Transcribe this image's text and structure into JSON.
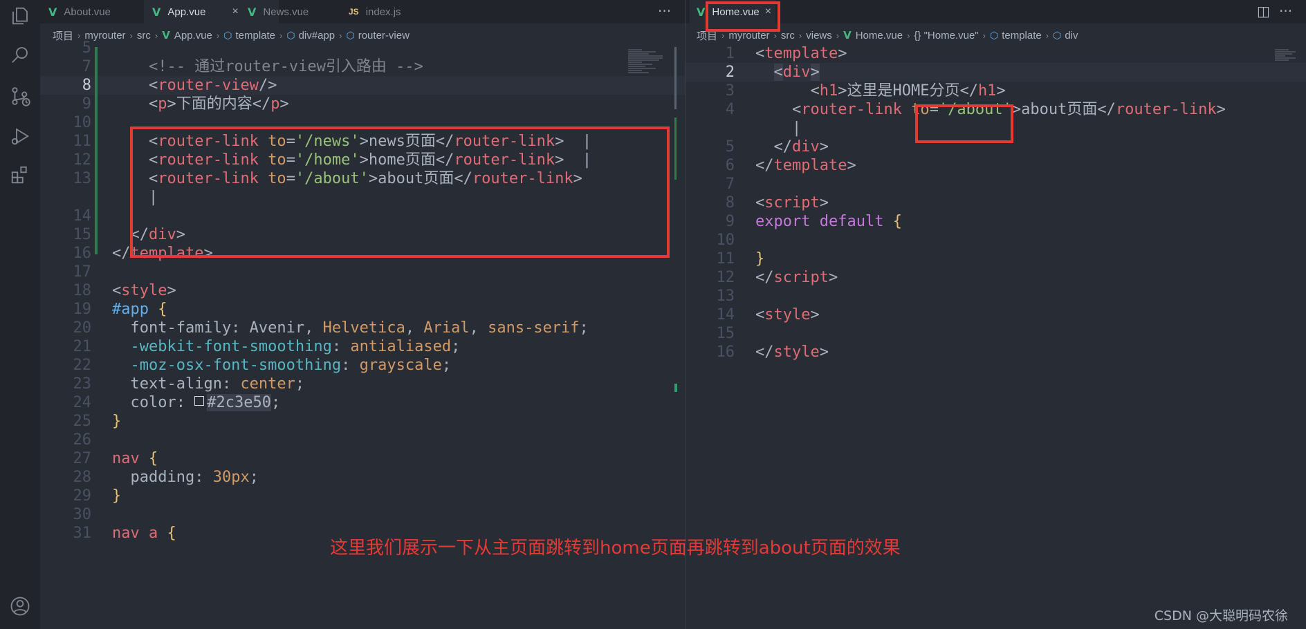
{
  "left_editor": {
    "tabs": [
      {
        "icon": "vue-icon",
        "label": "About.vue"
      },
      {
        "icon": "vue-icon",
        "label": "App.vue",
        "close": "×"
      },
      {
        "icon": "vue-icon",
        "label": "News.vue"
      },
      {
        "icon": "js-icon",
        "icon_text": "JS",
        "label": "index.js"
      }
    ],
    "more": "···",
    "breadcrumb": [
      "项目",
      "myrouter",
      "src",
      "App.vue",
      "template",
      "div#app",
      "router-view"
    ],
    "lines": [
      {
        "n": "5",
        "segs": []
      },
      {
        "n": "7",
        "segs": [
          {
            "c": "t-com",
            "t": "    <!-- 通过router-view引入路由 -->"
          }
        ]
      },
      {
        "n": "8",
        "segs": [
          {
            "c": "t-br",
            "t": "    <"
          },
          {
            "c": "t-tag",
            "t": "router-view"
          },
          {
            "c": "t-br",
            "t": "/>"
          }
        ]
      },
      {
        "n": "9",
        "segs": [
          {
            "c": "t-br",
            "t": "    <"
          },
          {
            "c": "t-tag",
            "t": "p"
          },
          {
            "c": "t-br",
            "t": ">下面的内容</"
          },
          {
            "c": "t-tag",
            "t": "p"
          },
          {
            "c": "t-br",
            "t": ">"
          }
        ]
      },
      {
        "n": "10",
        "segs": []
      },
      {
        "n": "11",
        "segs": [
          {
            "c": "t-br",
            "t": "    <"
          },
          {
            "c": "t-tag",
            "t": "router-link"
          },
          {
            "c": "t-br",
            "t": " "
          },
          {
            "c": "t-attr",
            "t": "to"
          },
          {
            "c": "t-br",
            "t": "="
          },
          {
            "c": "t-str",
            "t": "'/news'"
          },
          {
            "c": "t-br",
            "t": ">news页面</"
          },
          {
            "c": "t-tag",
            "t": "router-link"
          },
          {
            "c": "t-br",
            "t": ">  |"
          }
        ]
      },
      {
        "n": "12",
        "segs": [
          {
            "c": "t-br",
            "t": "    <"
          },
          {
            "c": "t-tag",
            "t": "router-link"
          },
          {
            "c": "t-br",
            "t": " "
          },
          {
            "c": "t-attr",
            "t": "to"
          },
          {
            "c": "t-br",
            "t": "="
          },
          {
            "c": "t-str",
            "t": "'/home'"
          },
          {
            "c": "t-br",
            "t": ">home页面</"
          },
          {
            "c": "t-tag",
            "t": "router-link"
          },
          {
            "c": "t-br",
            "t": ">  |"
          }
        ]
      },
      {
        "n": "13",
        "segs": [
          {
            "c": "t-br",
            "t": "    <"
          },
          {
            "c": "t-tag",
            "t": "router-link"
          },
          {
            "c": "t-br",
            "t": " "
          },
          {
            "c": "t-attr",
            "t": "to"
          },
          {
            "c": "t-br",
            "t": "="
          },
          {
            "c": "t-str",
            "t": "'/about'"
          },
          {
            "c": "t-br",
            "t": ">about页面</"
          },
          {
            "c": "t-tag",
            "t": "router-link"
          },
          {
            "c": "t-br",
            "t": ">"
          }
        ]
      },
      {
        "n": "",
        "segs": [
          {
            "c": "t-br",
            "t": "    |"
          }
        ]
      },
      {
        "n": "14",
        "segs": []
      },
      {
        "n": "15",
        "segs": [
          {
            "c": "t-br",
            "t": "  </"
          },
          {
            "c": "t-tag",
            "t": "div"
          },
          {
            "c": "t-br",
            "t": ">"
          }
        ]
      },
      {
        "n": "16",
        "segs": [
          {
            "c": "t-br",
            "t": "</"
          },
          {
            "c": "t-tag",
            "t": "template"
          },
          {
            "c": "t-br",
            "t": ">"
          }
        ]
      },
      {
        "n": "17",
        "segs": []
      },
      {
        "n": "18",
        "segs": [
          {
            "c": "t-br",
            "t": "<"
          },
          {
            "c": "t-tag",
            "t": "style"
          },
          {
            "c": "t-br",
            "t": ">"
          }
        ]
      },
      {
        "n": "19",
        "segs": [
          {
            "c": "t-id",
            "t": "#app"
          },
          {
            "c": "t-br",
            "t": " "
          },
          {
            "c": "t-brace",
            "t": "{"
          }
        ]
      },
      {
        "n": "20",
        "segs": [
          {
            "c": "t-prop",
            "t": "  font-family: Avenir, "
          },
          {
            "c": "t-val",
            "t": "Helvetica"
          },
          {
            "c": "t-prop",
            "t": ", "
          },
          {
            "c": "t-val",
            "t": "Arial"
          },
          {
            "c": "t-prop",
            "t": ", "
          },
          {
            "c": "t-val",
            "t": "sans-serif"
          },
          {
            "c": "t-prop",
            "t": ";"
          }
        ]
      },
      {
        "n": "21",
        "segs": [
          {
            "c": "t-vprop",
            "t": "  -webkit-font-smoothing"
          },
          {
            "c": "t-prop",
            "t": ": "
          },
          {
            "c": "t-val",
            "t": "antialiased"
          },
          {
            "c": "t-prop",
            "t": ";"
          }
        ]
      },
      {
        "n": "22",
        "segs": [
          {
            "c": "t-vprop",
            "t": "  -moz-osx-font-smoothing"
          },
          {
            "c": "t-prop",
            "t": ": "
          },
          {
            "c": "t-val",
            "t": "grayscale"
          },
          {
            "c": "t-prop",
            "t": ";"
          }
        ]
      },
      {
        "n": "23",
        "segs": [
          {
            "c": "t-prop",
            "t": "  text-align: "
          },
          {
            "c": "t-val",
            "t": "center"
          },
          {
            "c": "t-prop",
            "t": ";"
          }
        ]
      },
      {
        "n": "24",
        "segs": [
          {
            "c": "t-prop",
            "t": "  color: "
          },
          {
            "c": "colorbox",
            "t": ""
          },
          {
            "c": "t-prop selbg",
            "t": "#2c3e50"
          },
          {
            "c": "t-prop",
            "t": ";"
          }
        ]
      },
      {
        "n": "25",
        "segs": [
          {
            "c": "t-brace",
            "t": "}"
          }
        ]
      },
      {
        "n": "26",
        "segs": []
      },
      {
        "n": "27",
        "segs": [
          {
            "c": "t-tag",
            "t": "nav"
          },
          {
            "c": "t-br",
            "t": " "
          },
          {
            "c": "t-brace",
            "t": "{"
          }
        ]
      },
      {
        "n": "28",
        "segs": [
          {
            "c": "t-prop",
            "t": "  padding: "
          },
          {
            "c": "t-num",
            "t": "30px"
          },
          {
            "c": "t-prop",
            "t": ";"
          }
        ]
      },
      {
        "n": "29",
        "segs": [
          {
            "c": "t-brace",
            "t": "}"
          }
        ]
      },
      {
        "n": "30",
        "segs": []
      },
      {
        "n": "31",
        "segs": [
          {
            "c": "t-tag",
            "t": "nav a"
          },
          {
            "c": "t-br",
            "t": " "
          },
          {
            "c": "t-brace",
            "t": "{"
          }
        ]
      }
    ]
  },
  "right_editor": {
    "tabs": [
      {
        "icon": "vue-icon",
        "label": "Home.vue",
        "close": "×"
      }
    ],
    "split_icon": "◫",
    "more": "···",
    "breadcrumb": [
      "项目",
      "myrouter",
      "src",
      "views",
      "Home.vue",
      "{} \"Home.vue\"",
      "template",
      "div"
    ],
    "lines": [
      {
        "n": "1",
        "segs": [
          {
            "c": "t-br",
            "t": "<"
          },
          {
            "c": "t-tag",
            "t": "template"
          },
          {
            "c": "t-br",
            "t": ">"
          }
        ]
      },
      {
        "n": "2",
        "segs": [
          {
            "c": "t-br",
            "t": "  "
          },
          {
            "c": "t-br selbg",
            "t": "<"
          },
          {
            "c": "t-tag",
            "t": "div"
          },
          {
            "c": "t-br selbg",
            "t": ">"
          }
        ]
      },
      {
        "n": "3",
        "segs": [
          {
            "c": "t-br",
            "t": "      <"
          },
          {
            "c": "t-tag",
            "t": "h1"
          },
          {
            "c": "t-br",
            "t": ">这里是HOME分页</"
          },
          {
            "c": "t-tag",
            "t": "h1"
          },
          {
            "c": "t-br",
            "t": ">"
          }
        ]
      },
      {
        "n": "4",
        "segs": [
          {
            "c": "t-br",
            "t": "    <"
          },
          {
            "c": "t-tag",
            "t": "router-link"
          },
          {
            "c": "t-br",
            "t": " "
          },
          {
            "c": "t-attr",
            "t": "to"
          },
          {
            "c": "t-br",
            "t": "="
          },
          {
            "c": "t-str",
            "t": "'/about'"
          },
          {
            "c": "t-br",
            "t": ">about页面</"
          },
          {
            "c": "t-tag",
            "t": "router-link"
          },
          {
            "c": "t-br",
            "t": ">"
          }
        ]
      },
      {
        "n": "",
        "segs": [
          {
            "c": "t-br",
            "t": "    |"
          }
        ]
      },
      {
        "n": "5",
        "segs": [
          {
            "c": "t-br",
            "t": "  </"
          },
          {
            "c": "t-tag",
            "t": "div"
          },
          {
            "c": "t-br",
            "t": ">"
          }
        ]
      },
      {
        "n": "6",
        "segs": [
          {
            "c": "t-br",
            "t": "</"
          },
          {
            "c": "t-tag",
            "t": "template"
          },
          {
            "c": "t-br",
            "t": ">"
          }
        ]
      },
      {
        "n": "7",
        "segs": []
      },
      {
        "n": "8",
        "segs": [
          {
            "c": "t-br",
            "t": "<"
          },
          {
            "c": "t-tag",
            "t": "script"
          },
          {
            "c": "t-br",
            "t": ">"
          }
        ]
      },
      {
        "n": "9",
        "segs": [
          {
            "c": "t-kw",
            "t": "export"
          },
          {
            "c": "t-br",
            "t": " "
          },
          {
            "c": "t-kw",
            "t": "default"
          },
          {
            "c": "t-br",
            "t": " "
          },
          {
            "c": "t-brace",
            "t": "{"
          }
        ]
      },
      {
        "n": "10",
        "segs": []
      },
      {
        "n": "11",
        "segs": [
          {
            "c": "t-brace",
            "t": "}"
          }
        ]
      },
      {
        "n": "12",
        "segs": [
          {
            "c": "t-br",
            "t": "</"
          },
          {
            "c": "t-tag",
            "t": "script"
          },
          {
            "c": "t-br",
            "t": ">"
          }
        ]
      },
      {
        "n": "13",
        "segs": []
      },
      {
        "n": "14",
        "segs": [
          {
            "c": "t-br",
            "t": "<"
          },
          {
            "c": "t-tag",
            "t": "style"
          },
          {
            "c": "t-br",
            "t": ">"
          }
        ]
      },
      {
        "n": "15",
        "segs": []
      },
      {
        "n": "16",
        "segs": [
          {
            "c": "t-br",
            "t": "</"
          },
          {
            "c": "t-tag",
            "t": "style"
          },
          {
            "c": "t-br",
            "t": ">"
          }
        ]
      }
    ]
  },
  "annotation": "这里我们展示一下从主页面跳转到home页面再跳转到about页面的效果",
  "watermark": "CSDN @大聪明码农徐",
  "colors": {
    "highlight_box": "#e53935",
    "background": "#282c34",
    "vue_green": "#42b883"
  }
}
